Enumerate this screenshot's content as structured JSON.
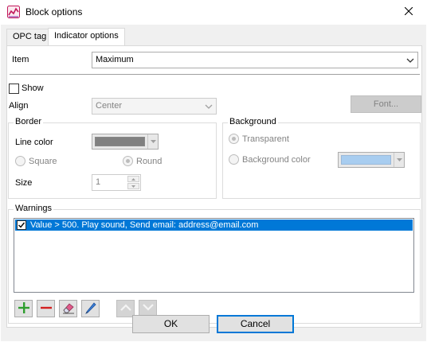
{
  "window": {
    "title": "Block options",
    "app_icon": "chart-line-icon",
    "close_icon": "close-icon"
  },
  "tabs": [
    {
      "label": "OPC tag",
      "active": false
    },
    {
      "label": "Indicator options",
      "active": true
    }
  ],
  "item": {
    "label": "Item",
    "value": "Maximum"
  },
  "show": {
    "label": "Show",
    "checked": false
  },
  "align": {
    "label": "Align",
    "value": "Center"
  },
  "font_button": {
    "label": "Font..."
  },
  "border": {
    "title": "Border",
    "line_color_label": "Line color",
    "line_color": "#808080",
    "square_label": "Square",
    "round_label": "Round",
    "selected_shape": "Round",
    "size_label": "Size",
    "size_value": "1"
  },
  "background": {
    "title": "Background",
    "transparent_label": "Transparent",
    "color_label": "Background color",
    "selected": "Transparent",
    "color": "#a8cdf0"
  },
  "warnings": {
    "title": "Warnings",
    "items": [
      {
        "text": "Value > 500. Play sound, Send email: address@email.com",
        "checked": true,
        "selected": true
      }
    ],
    "toolbar": [
      {
        "name": "add-icon",
        "enabled": true
      },
      {
        "name": "remove-icon",
        "enabled": true
      },
      {
        "name": "eraser-icon",
        "enabled": true
      },
      {
        "name": "pencil-icon",
        "enabled": true
      },
      {
        "name": "arrow-up-icon",
        "enabled": false
      },
      {
        "name": "arrow-down-icon",
        "enabled": false
      }
    ]
  },
  "buttons": {
    "ok": "OK",
    "cancel": "Cancel"
  },
  "colors": {
    "accent": "#0078d7",
    "dialog_bg": "#f0f0f0",
    "add_green": "#2e9e2e",
    "remove_red": "#d32020"
  }
}
